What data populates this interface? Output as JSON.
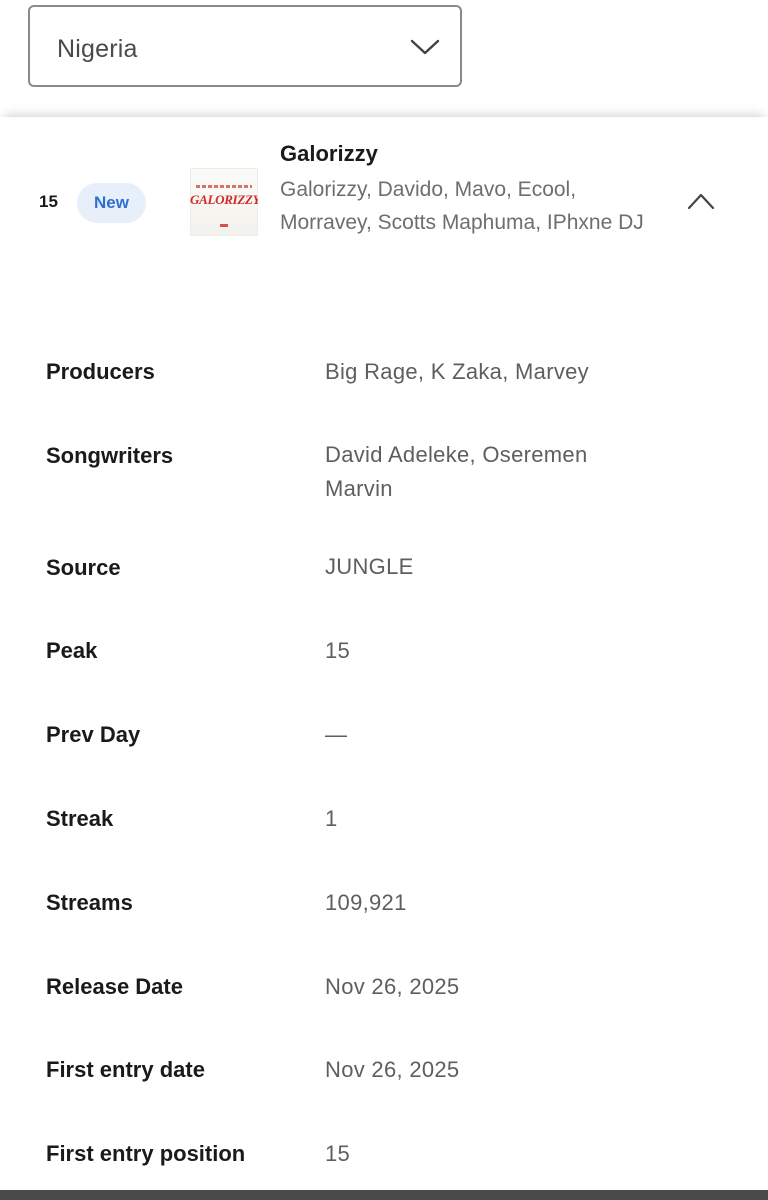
{
  "country_select": {
    "value": "Nigeria",
    "icon": "chevron-down-icon"
  },
  "track": {
    "rank": "15",
    "badge": "New",
    "cover_text": "GALORIZZY",
    "title": "Galorizzy",
    "artists": "Galorizzy, Davido, Mavo, Ecool, Morravey, Scotts Maphuma, IPhxne DJ",
    "toggle_icon": "chevron-up-icon"
  },
  "details": [
    {
      "label": "Producers",
      "value": "Big Rage, K Zaka, Marvey"
    },
    {
      "label": "Songwriters",
      "value": "David Adeleke, Oseremen Marvin"
    },
    {
      "label": "Source",
      "value": "JUNGLE"
    },
    {
      "label": "Peak",
      "value": "15"
    },
    {
      "label": "Prev Day",
      "value": "—"
    },
    {
      "label": "Streak",
      "value": "1"
    },
    {
      "label": "Streams",
      "value": "109,921"
    },
    {
      "label": "Release Date",
      "value": "Nov 26, 2025"
    },
    {
      "label": "First entry date",
      "value": "Nov 26, 2025"
    },
    {
      "label": "First entry position",
      "value": "15"
    }
  ],
  "colors": {
    "badge_bg": "#e6effa",
    "badge_text": "#2f6fcf",
    "cover_accent": "#cf2b2b"
  }
}
